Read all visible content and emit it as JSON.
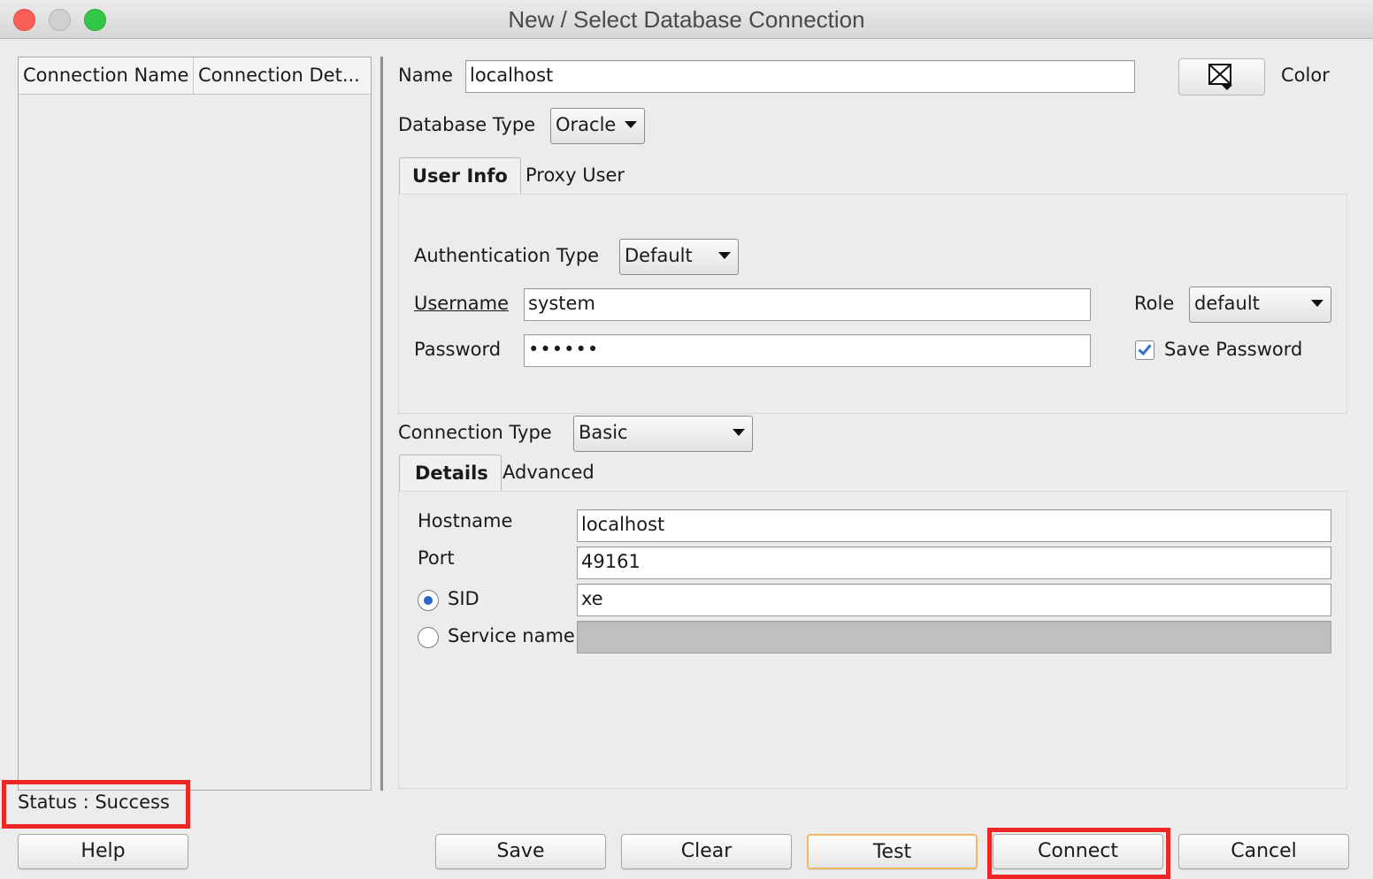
{
  "window": {
    "title": "New / Select Database Connection"
  },
  "connections_list": {
    "columns": [
      "Connection Name",
      "Connection Det..."
    ]
  },
  "form": {
    "name_label": "Name",
    "name_value": "localhost",
    "color_label": "Color",
    "database_type_label": "Database Type",
    "database_type_value": "Oracle",
    "tabs": [
      "User Info",
      "Proxy User"
    ],
    "active_tab": "User Info",
    "auth_type_label": "Authentication Type",
    "auth_type_value": "Default",
    "username_label": "Username",
    "username_value": "system",
    "password_label": "Password",
    "password_value": "••••••",
    "role_label": "Role",
    "role_value": "default",
    "save_password_label": "Save Password",
    "save_password_checked": true,
    "connection_type_label": "Connection Type",
    "connection_type_value": "Basic",
    "detail_tabs": [
      "Details",
      "Advanced"
    ],
    "active_detail_tab": "Details",
    "hostname_label": "Hostname",
    "hostname_value": "localhost",
    "port_label": "Port",
    "port_value": "49161",
    "sid_label": "SID",
    "sid_value": "xe",
    "sid_selected": true,
    "service_name_label": "Service name",
    "service_name_value": ""
  },
  "status": {
    "text": "Status : Success"
  },
  "buttons": {
    "help": "Help",
    "save": "Save",
    "clear": "Clear",
    "test": "Test",
    "connect": "Connect",
    "cancel": "Cancel"
  },
  "colors": {
    "highlight": "#ee2626",
    "default_button_border": "#f0b966",
    "accent": "#2f6fd6"
  }
}
